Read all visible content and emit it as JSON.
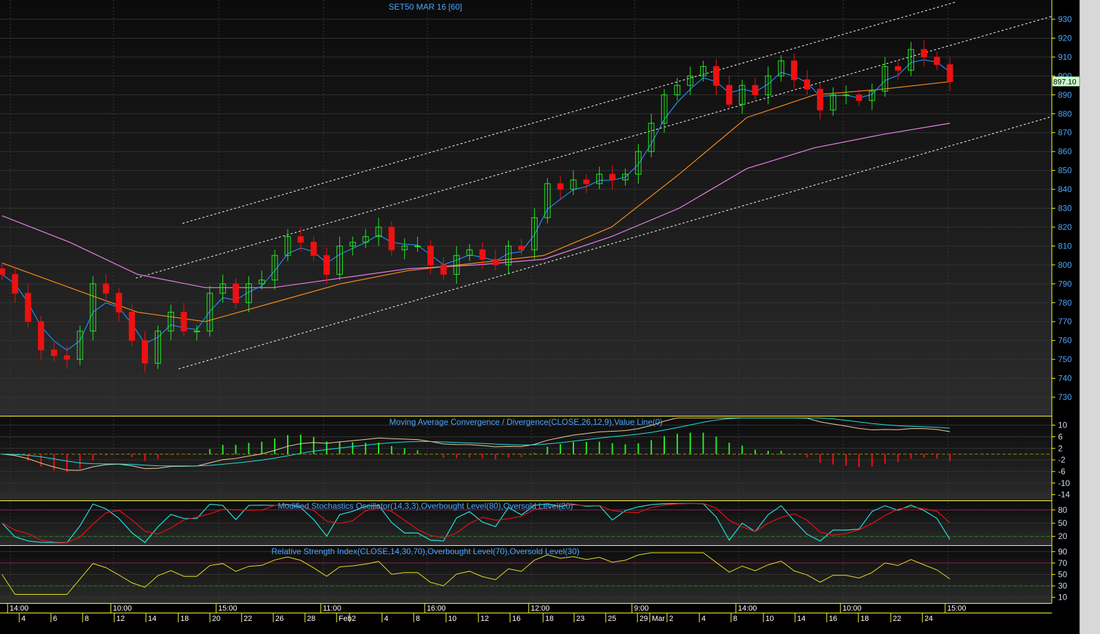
{
  "chart_data": {
    "type": "candlestick",
    "title": "SET50 MAR 16   [60]",
    "last_price_label": "897.10",
    "ylim": [
      722,
      937
    ],
    "y_ticks": [
      930,
      920,
      910,
      900,
      890,
      880,
      870,
      860,
      850,
      840,
      830,
      820,
      810,
      800,
      790,
      780,
      770,
      760,
      750,
      740,
      730
    ],
    "close": [
      795,
      785,
      770,
      755,
      752,
      750,
      765,
      790,
      785,
      775,
      760,
      748,
      765,
      775,
      765,
      765,
      785,
      790,
      780,
      790,
      792,
      805,
      815,
      812,
      805,
      795,
      810,
      812,
      815,
      820,
      808,
      810,
      810,
      800,
      795,
      805,
      808,
      803,
      800,
      810,
      808,
      825,
      843,
      840,
      845,
      843,
      848,
      845,
      848,
      860,
      875,
      890,
      895,
      900,
      905,
      895,
      885,
      895,
      890,
      900,
      908,
      898,
      893,
      882,
      890,
      890,
      887,
      892,
      905,
      903,
      914,
      910,
      906,
      897
    ],
    "ma_long": [
      826,
      812,
      795,
      788,
      788,
      793,
      798,
      800,
      803,
      815,
      830,
      851,
      862,
      869,
      875
    ],
    "ma_mid": [
      801,
      788,
      775,
      770,
      780,
      790,
      797,
      801,
      805,
      820,
      848,
      878,
      890,
      893,
      897
    ],
    "trend_lines": [
      {
        "from": [
          13.9,
          822
        ],
        "to": [
          73.4,
          939
        ]
      },
      {
        "from": [
          10.3,
          793
        ],
        "to": [
          82.1,
          934
        ]
      },
      {
        "from": [
          13.6,
          745
        ],
        "to": [
          82.1,
          881
        ]
      }
    ],
    "colors": {
      "up": "#22ee22",
      "down": "#ee1111",
      "ma_short": "#1e90ff",
      "ma_mid": "#ff8c1a",
      "ma_long": "#ee82ee",
      "axis": "#ffff33",
      "axis_text": "#4da6ff"
    },
    "macd": {
      "title": "Moving Average Convergence / Divergence(CLOSE,26,12,9),Value Line(0)",
      "y_ticks": [
        10,
        6,
        2,
        -2,
        -6,
        -10,
        -14
      ],
      "ylim": [
        -16,
        13
      ]
    },
    "stochastic": {
      "title": "Modified Stochastics Oscillator(14,3,3),Overbought Level(80),Oversold Level(20)",
      "y_ticks": [
        80,
        50,
        20
      ],
      "ylim": [
        0,
        100
      ]
    },
    "rsi": {
      "title": "Relative Strength Index(CLOSE,14,30,70),Overbought Level(70),Oversold Level(30)",
      "y_ticks": [
        90,
        70,
        50,
        30,
        10
      ],
      "ylim": [
        0,
        100
      ]
    },
    "time_labels": [
      "14:00",
      "10:00",
      "15:00",
      "11:00",
      "16:00",
      "12:00",
      "9:00",
      "14:00",
      "10:00",
      "15:00"
    ],
    "date_labels": [
      "4",
      "6",
      "8",
      "12",
      "14",
      "18",
      "20",
      "22",
      "26",
      "28",
      "Feb",
      "2",
      "4",
      "8",
      "10",
      "12",
      "16",
      "18",
      "23",
      "25",
      "29",
      "Mar",
      "2",
      "4",
      "8",
      "10",
      "14",
      "16",
      "18",
      "22",
      "24"
    ]
  }
}
